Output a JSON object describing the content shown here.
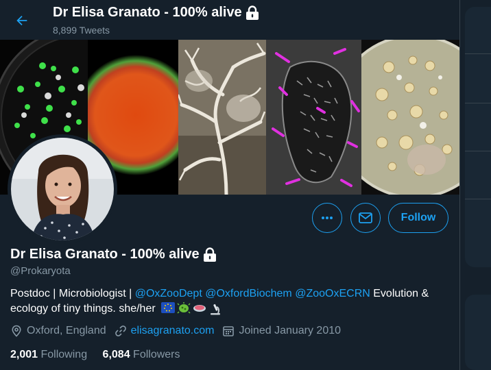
{
  "header": {
    "name": "Dr Elisa Granato - 100% alive",
    "tweet_count": "8,899 Tweets"
  },
  "profile": {
    "name": "Dr Elisa Granato - 100% alive",
    "handle": "@Prokaryota",
    "bio": {
      "prefix": "Postdoc | Microbiologist | ",
      "mention1": "@OxZooDept",
      "mention2": "@OxfordBiochem",
      "mention3": "@ZooOxECRN",
      "suffix": " Evolution & ecology of tiny things. she/her"
    },
    "location": "Oxford, England",
    "website": "elisagranato.com",
    "joined": "Joined January 2010",
    "following_count": "2,001",
    "following_label": "Following",
    "followers_count": "6,084",
    "followers_label": "Followers"
  },
  "actions": {
    "follow_label": "Follow"
  },
  "colors": {
    "background": "#15202b",
    "accent": "#1da1f2",
    "secondary_text": "#8899a6"
  },
  "icons": {
    "back": "arrow-left-icon",
    "lock": "lock-icon",
    "more": "more-icon",
    "message": "envelope-icon",
    "location": "location-pin-icon",
    "link": "link-icon",
    "calendar": "calendar-icon"
  }
}
